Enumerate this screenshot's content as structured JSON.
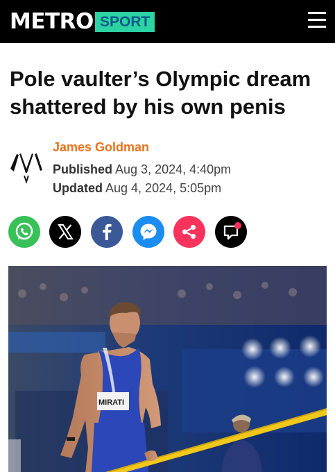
{
  "header": {
    "logo": "METRO",
    "section": "SPORT",
    "colors": {
      "bar": "#000000",
      "section_bg": "#2cd3a3",
      "section_text": "#0a5c8a"
    }
  },
  "article": {
    "title": "Pole vaulter’s Olympic dream shattered by his own penis",
    "author": "James Goldman",
    "published_label": "Published",
    "published_value": "Aug 3, 2024, 4:40pm",
    "updated_label": "Updated",
    "updated_value": "Aug 4, 2024, 5:05pm",
    "author_color": "#e8741d",
    "bib_text": "MIRATI"
  },
  "share": [
    {
      "name": "whatsapp-share",
      "icon": "whatsapp-icon",
      "color": "#38c158"
    },
    {
      "name": "x-share",
      "icon": "x-icon",
      "color": "#000000"
    },
    {
      "name": "facebook-share",
      "icon": "facebook-icon",
      "color": "#3b5998"
    },
    {
      "name": "messenger-share",
      "icon": "messenger-icon",
      "color": "#1b8cf2"
    },
    {
      "name": "generic-share",
      "icon": "share-icon",
      "color": "#fa335c"
    },
    {
      "name": "comments-button",
      "icon": "comment-icon",
      "color": "#000000"
    }
  ]
}
